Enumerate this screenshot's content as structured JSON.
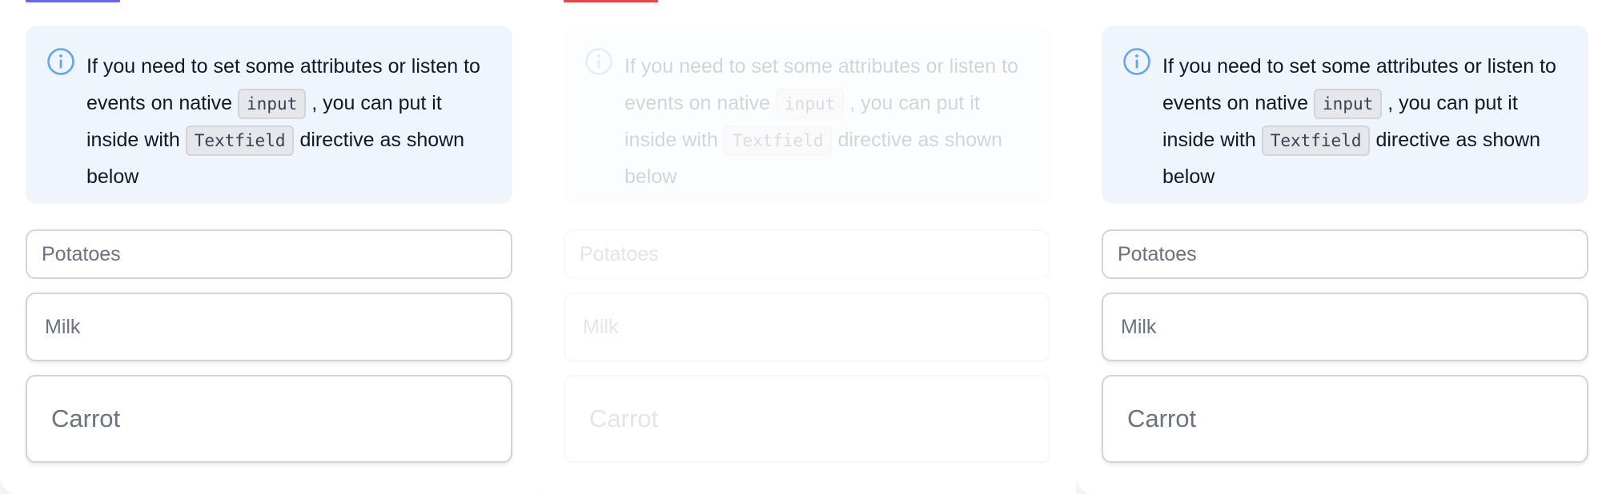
{
  "info": {
    "text_1": "If you need to set some attributes or listen to events on native",
    "code_1": "input",
    "text_2": ", you can put it inside with",
    "code_2": "Textfield",
    "text_3": "directive as shown below"
  },
  "fields": {
    "small": "Potatoes",
    "medium": "Milk",
    "large": "Carrot"
  },
  "colors": {
    "panel1_accent": "#6366f1",
    "panel2_accent": "#ef4444",
    "info_bg": "#eef5fd",
    "info_icon": "#60a5fa"
  }
}
